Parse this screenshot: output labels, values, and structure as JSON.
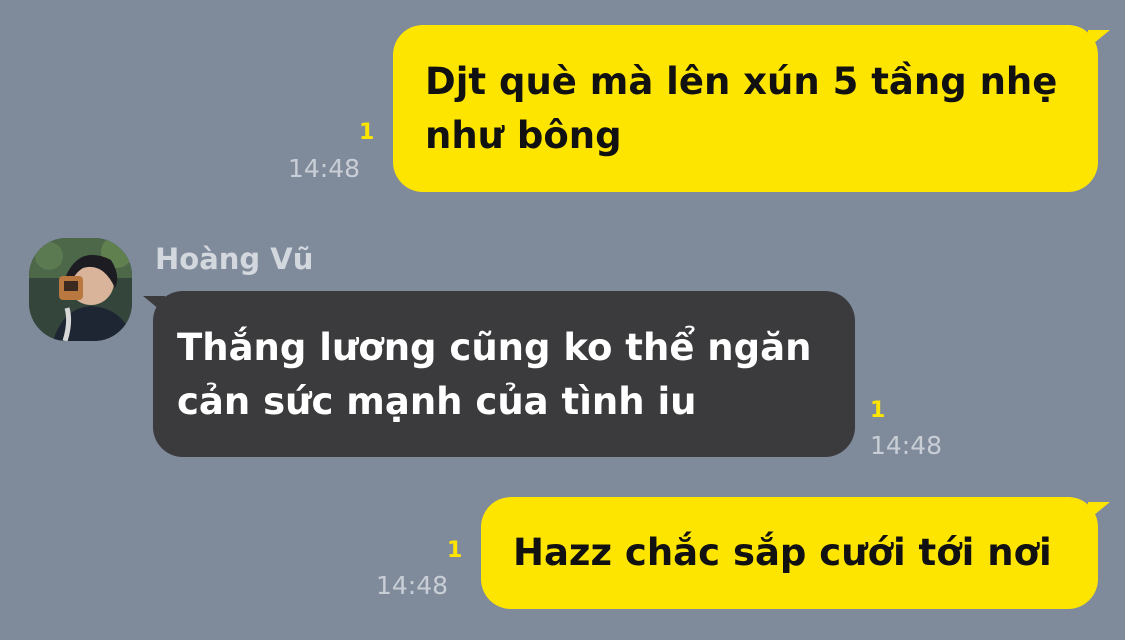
{
  "messages": [
    {
      "direction": "outgoing",
      "text": "Djt què mà lên xún 5 tầng nhẹ như bông",
      "unread_count": "1",
      "time": "14:48"
    },
    {
      "direction": "incoming",
      "sender": "Hoàng Vũ",
      "avatar_icon": "user-avatar-photo",
      "text": "Thắng lương cũng ko thể ngăn cản sức mạnh của tình iu",
      "unread_count": "1",
      "time": "14:48"
    },
    {
      "direction": "outgoing",
      "text": "Hazz chắc sắp cưới tới nơi",
      "unread_count": "1",
      "time": "14:48"
    }
  ],
  "colors": {
    "background": "#7f8a9b",
    "outgoing_bubble": "#fee500",
    "incoming_bubble": "#3b3b3d",
    "unread_badge": "#fee500"
  }
}
